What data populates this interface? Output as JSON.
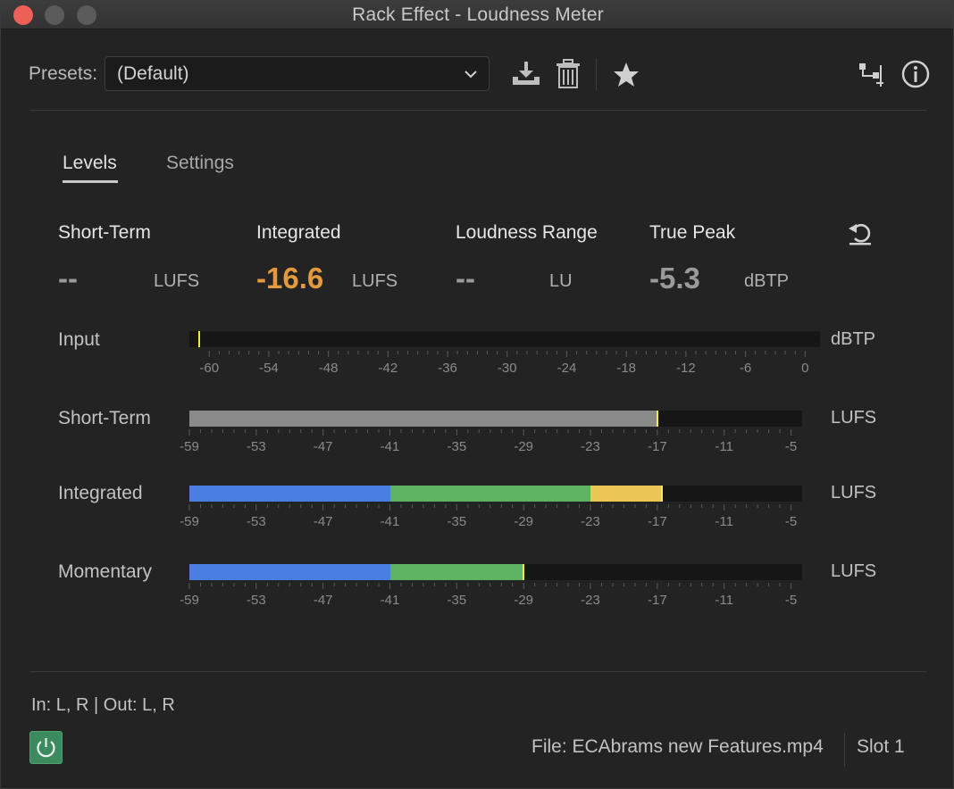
{
  "window": {
    "title": "Rack Effect - Loudness Meter"
  },
  "presets": {
    "label": "Presets:",
    "selected": "(Default)"
  },
  "tabs": [
    {
      "label": "Levels",
      "active": true
    },
    {
      "label": "Settings",
      "active": false
    }
  ],
  "stats": [
    {
      "label": "Short-Term",
      "value": "--",
      "unit": "LUFS"
    },
    {
      "label": "Integrated",
      "value": "-16.6",
      "unit": "LUFS"
    },
    {
      "label": "Loudness Range",
      "value": "--",
      "unit": "LU"
    },
    {
      "label": "True Peak",
      "value": "-5.3",
      "unit": "dBTP"
    }
  ],
  "meters": {
    "input": {
      "label": "Input",
      "unit": "dBTP",
      "scale_min": -62,
      "scale_max": 1.5,
      "ticks": [
        "-60",
        "-54",
        "-48",
        "-42",
        "-36",
        "-30",
        "-24",
        "-18",
        "-12",
        "-6",
        "0"
      ],
      "cursor": -61,
      "segments": []
    },
    "short_term": {
      "label": "Short-Term",
      "unit": "LUFS",
      "scale_min": -59,
      "scale_max": -4,
      "ticks": [
        "-59",
        "-53",
        "-47",
        "-41",
        "-35",
        "-29",
        "-23",
        "-17",
        "-11",
        "-5"
      ],
      "cursor": -17,
      "segments": [
        {
          "from": -59,
          "to": -17,
          "color": "#8a8a8a"
        }
      ]
    },
    "integrated": {
      "label": "Integrated",
      "unit": "LUFS",
      "scale_min": -59,
      "scale_max": -4,
      "ticks": [
        "-59",
        "-53",
        "-47",
        "-41",
        "-35",
        "-29",
        "-23",
        "-17",
        "-11",
        "-5"
      ],
      "cursor": -16.6,
      "segments": [
        {
          "from": -59,
          "to": -41,
          "color": "#4a7ee0"
        },
        {
          "from": -41,
          "to": -23,
          "color": "#5fb261"
        },
        {
          "from": -23,
          "to": -16.6,
          "color": "#e9c655"
        }
      ]
    },
    "momentary": {
      "label": "Momentary",
      "unit": "LUFS",
      "scale_min": -59,
      "scale_max": -4,
      "ticks": [
        "-59",
        "-53",
        "-47",
        "-41",
        "-35",
        "-29",
        "-23",
        "-17",
        "-11",
        "-5"
      ],
      "cursor": -29,
      "segments": [
        {
          "from": -59,
          "to": -41,
          "color": "#4a7ee0"
        },
        {
          "from": -41,
          "to": -29,
          "color": "#5fb261"
        }
      ]
    }
  },
  "footer": {
    "io": "In: L, R | Out: L, R",
    "file": "File: ECAbrams new Features.mp4",
    "slot": "Slot 1"
  },
  "colors": {
    "accent_orange": "#e39a3c",
    "power_green": "#3d8a5e",
    "cursor_yellow": "#f2e84a",
    "close_red": "#ee5f58"
  },
  "icons": {
    "close": "close-icon",
    "minimize": "minimize-icon",
    "maximize": "maximize-icon",
    "dropdown": "chevron-down-icon",
    "save": "download-icon",
    "delete": "trash-icon",
    "favorite": "star-icon",
    "routing": "routing-icon",
    "info": "info-icon",
    "reset": "reset-icon",
    "power": "power-icon"
  }
}
